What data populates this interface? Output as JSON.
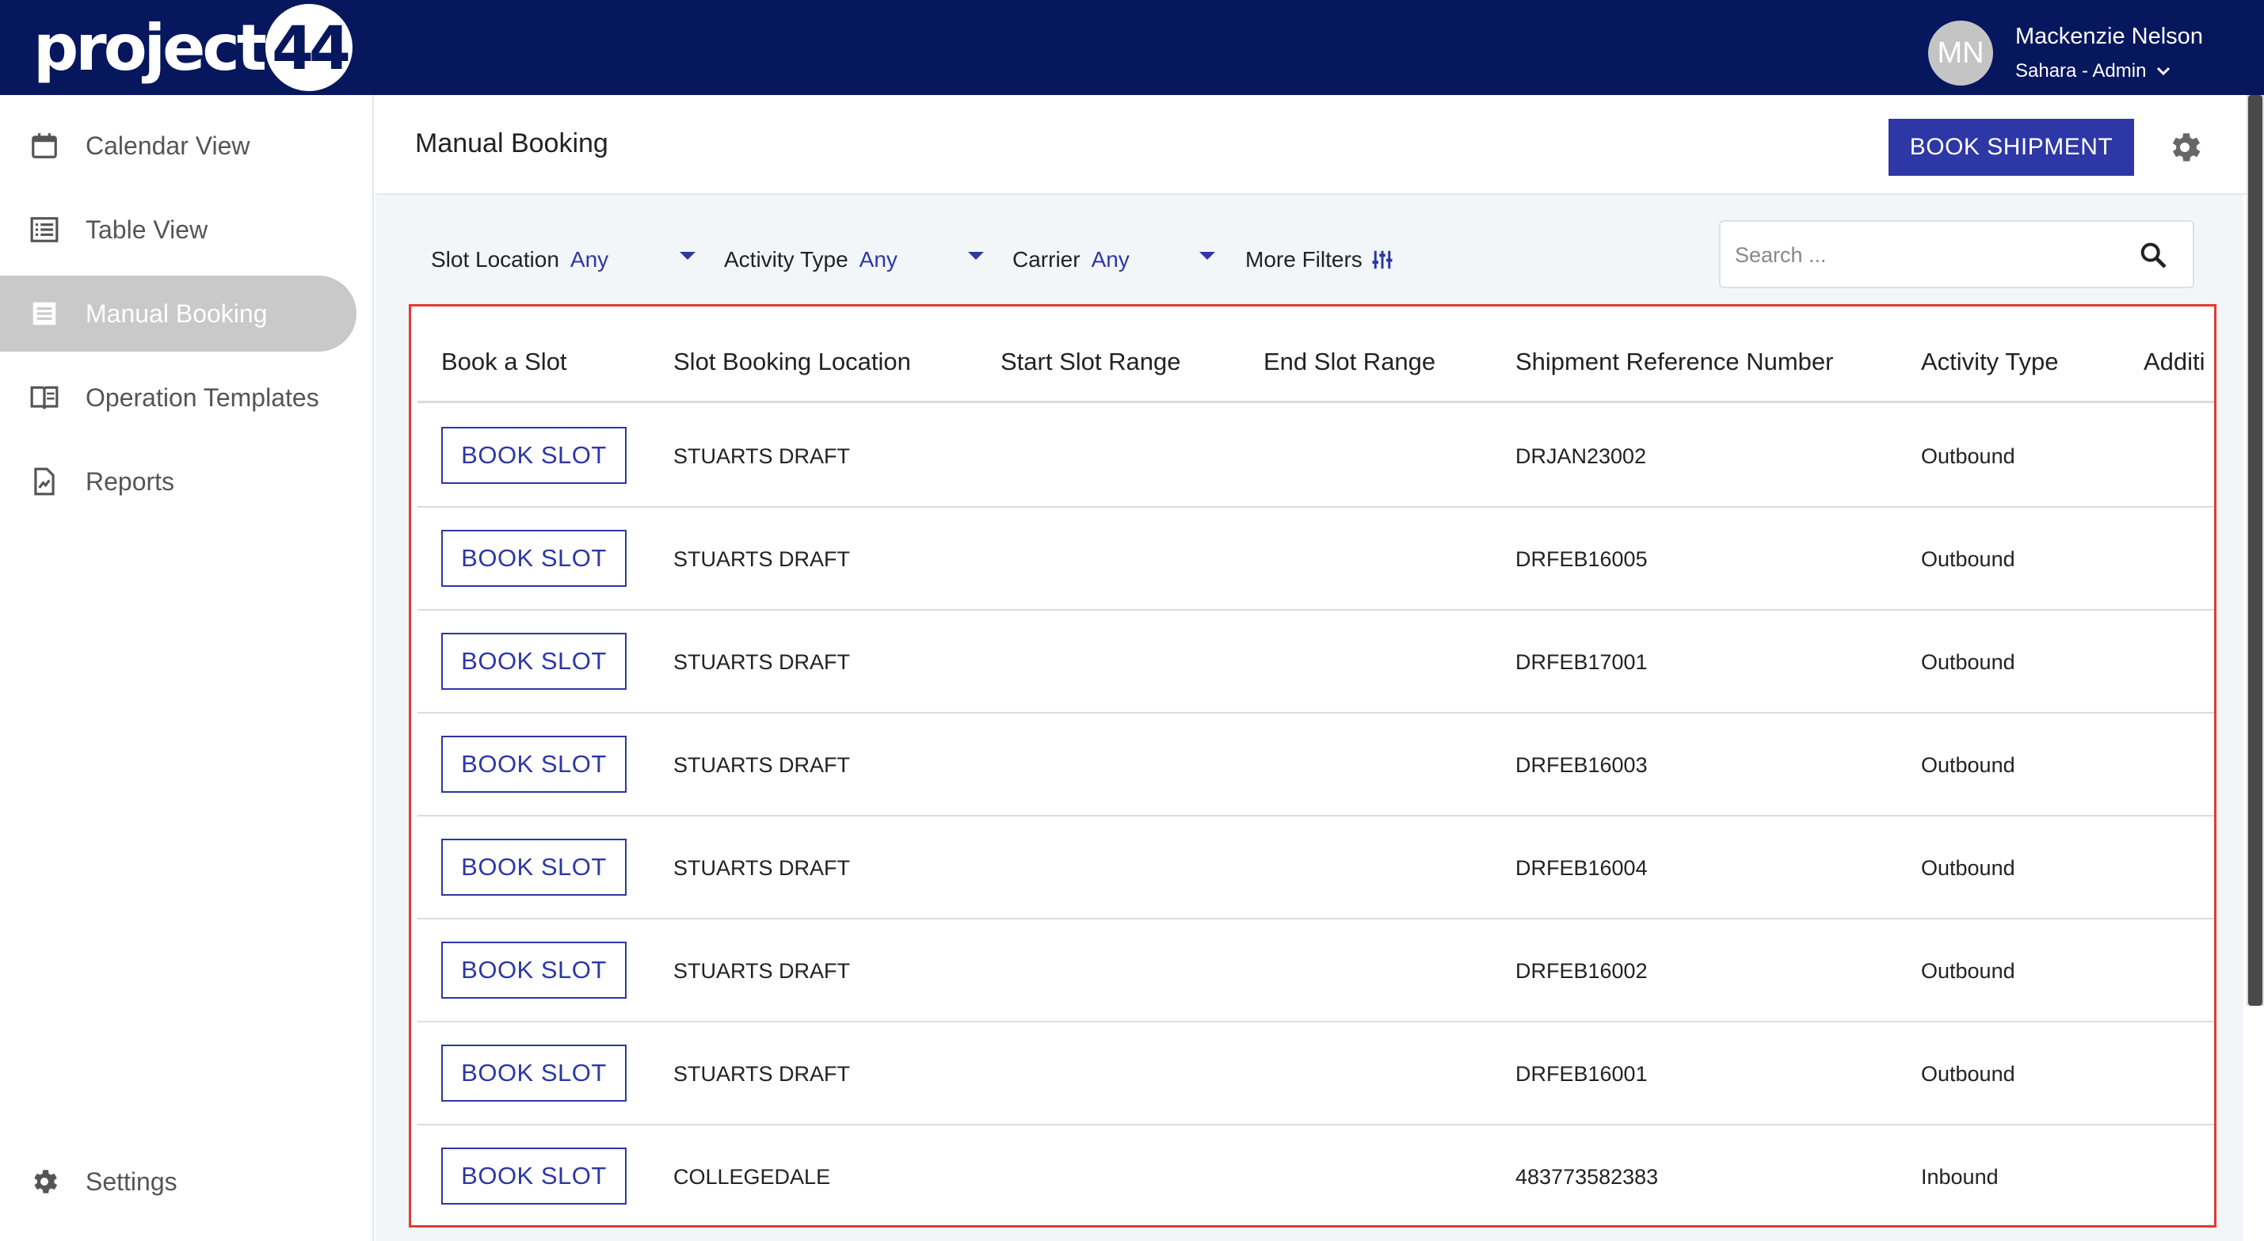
{
  "app": {
    "logo_text": "project",
    "logo_number": "44"
  },
  "user": {
    "initials": "MN",
    "name": "Mackenzie Nelson",
    "role": "Sahara - Admin"
  },
  "sidebar": {
    "items": [
      {
        "label": "Calendar View",
        "icon": "calendar-icon"
      },
      {
        "label": "Table View",
        "icon": "list-icon"
      },
      {
        "label": "Manual Booking",
        "icon": "list-alt-icon",
        "active": true
      },
      {
        "label": "Operation Templates",
        "icon": "book-icon"
      },
      {
        "label": "Reports",
        "icon": "report-icon"
      }
    ],
    "settings_label": "Settings"
  },
  "header": {
    "title": "Manual Booking",
    "book_shipment_label": "BOOK SHIPMENT"
  },
  "filters": {
    "slot_location": {
      "label": "Slot Location",
      "value": "Any"
    },
    "activity_type": {
      "label": "Activity Type",
      "value": "Any"
    },
    "carrier": {
      "label": "Carrier",
      "value": "Any"
    },
    "more_filters_label": "More Filters",
    "search_placeholder": "Search ..."
  },
  "table": {
    "columns": [
      "Book a Slot",
      "Slot Booking Location",
      "Start Slot Range",
      "End Slot Range",
      "Shipment Reference Number",
      "Activity Type",
      "Additi"
    ],
    "book_slot_label": "BOOK SLOT",
    "rows": [
      {
        "location": "STUARTS DRAFT",
        "start": "",
        "end": "",
        "reference": "DRJAN23002",
        "activity": "Outbound"
      },
      {
        "location": "STUARTS DRAFT",
        "start": "",
        "end": "",
        "reference": "DRFEB16005",
        "activity": "Outbound"
      },
      {
        "location": "STUARTS DRAFT",
        "start": "",
        "end": "",
        "reference": "DRFEB17001",
        "activity": "Outbound"
      },
      {
        "location": "STUARTS DRAFT",
        "start": "",
        "end": "",
        "reference": "DRFEB16003",
        "activity": "Outbound"
      },
      {
        "location": "STUARTS DRAFT",
        "start": "",
        "end": "",
        "reference": "DRFEB16004",
        "activity": "Outbound"
      },
      {
        "location": "STUARTS DRAFT",
        "start": "",
        "end": "",
        "reference": "DRFEB16002",
        "activity": "Outbound"
      },
      {
        "location": "STUARTS DRAFT",
        "start": "",
        "end": "",
        "reference": "DRFEB16001",
        "activity": "Outbound"
      },
      {
        "location": "COLLEGEDALE",
        "start": "",
        "end": "",
        "reference": "483773582383",
        "activity": "Inbound"
      }
    ]
  },
  "colors": {
    "topbar": "#06175e",
    "accent": "#2d37a5",
    "highlight_border": "#e53935"
  }
}
